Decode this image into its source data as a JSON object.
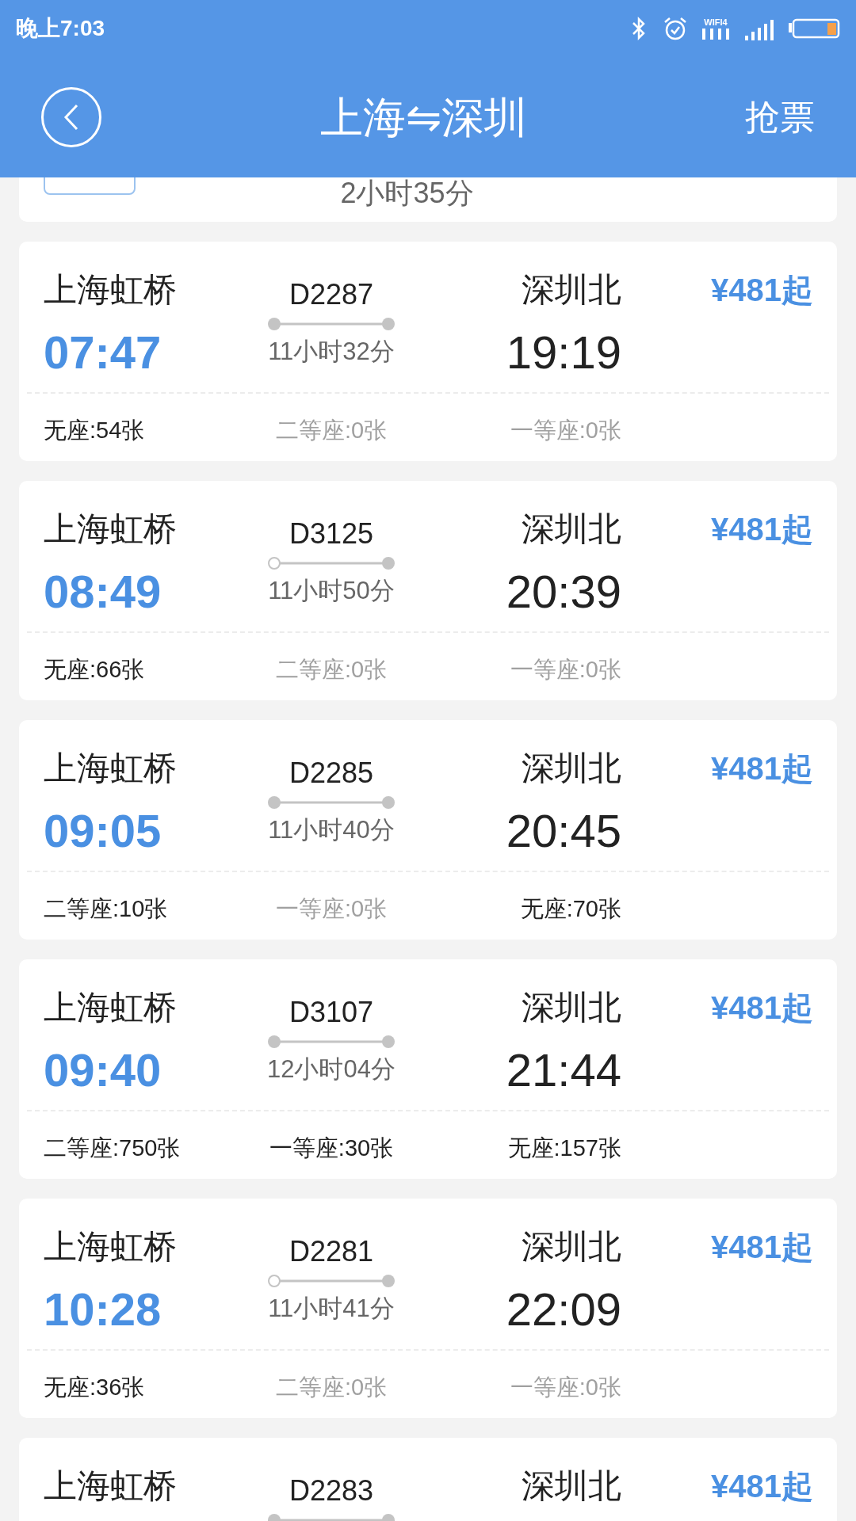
{
  "status_bar": {
    "time": "晚上7:03",
    "wifi_label": "WIFI4"
  },
  "header": {
    "title": "上海⇋深圳",
    "action": "抢票"
  },
  "previous_card": {
    "duration": "2小时35分"
  },
  "trains": [
    {
      "from_station": "上海虹桥",
      "depart": "07:47",
      "train_no": "D2287",
      "starts_here": true,
      "duration": "11小时32分",
      "to_station": "深圳北",
      "arrive": "19:19",
      "price": "¥481起",
      "seats": [
        {
          "text": "无座:54张",
          "available": true
        },
        {
          "text": "二等座:0张",
          "available": false
        },
        {
          "text": "一等座:0张",
          "available": false
        }
      ]
    },
    {
      "from_station": "上海虹桥",
      "depart": "08:49",
      "train_no": "D3125",
      "starts_here": false,
      "duration": "11小时50分",
      "to_station": "深圳北",
      "arrive": "20:39",
      "price": "¥481起",
      "seats": [
        {
          "text": "无座:66张",
          "available": true
        },
        {
          "text": "二等座:0张",
          "available": false
        },
        {
          "text": "一等座:0张",
          "available": false
        }
      ]
    },
    {
      "from_station": "上海虹桥",
      "depart": "09:05",
      "train_no": "D2285",
      "starts_here": true,
      "duration": "11小时40分",
      "to_station": "深圳北",
      "arrive": "20:45",
      "price": "¥481起",
      "seats": [
        {
          "text": "二等座:10张",
          "available": true
        },
        {
          "text": "一等座:0张",
          "available": false
        },
        {
          "text": "无座:70张",
          "available": true
        }
      ]
    },
    {
      "from_station": "上海虹桥",
      "depart": "09:40",
      "train_no": "D3107",
      "starts_here": true,
      "duration": "12小时04分",
      "to_station": "深圳北",
      "arrive": "21:44",
      "price": "¥481起",
      "seats": [
        {
          "text": "二等座:750张",
          "available": true
        },
        {
          "text": "一等座:30张",
          "available": true
        },
        {
          "text": "无座:157张",
          "available": true
        }
      ]
    },
    {
      "from_station": "上海虹桥",
      "depart": "10:28",
      "train_no": "D2281",
      "starts_here": false,
      "duration": "11小时41分",
      "to_station": "深圳北",
      "arrive": "22:09",
      "price": "¥481起",
      "seats": [
        {
          "text": "无座:36张",
          "available": true
        },
        {
          "text": "二等座:0张",
          "available": false
        },
        {
          "text": "一等座:0张",
          "available": false
        }
      ]
    },
    {
      "from_station": "上海虹桥",
      "train_no": "D2283",
      "starts_here": true,
      "to_station": "深圳北",
      "price": "¥481起"
    }
  ]
}
